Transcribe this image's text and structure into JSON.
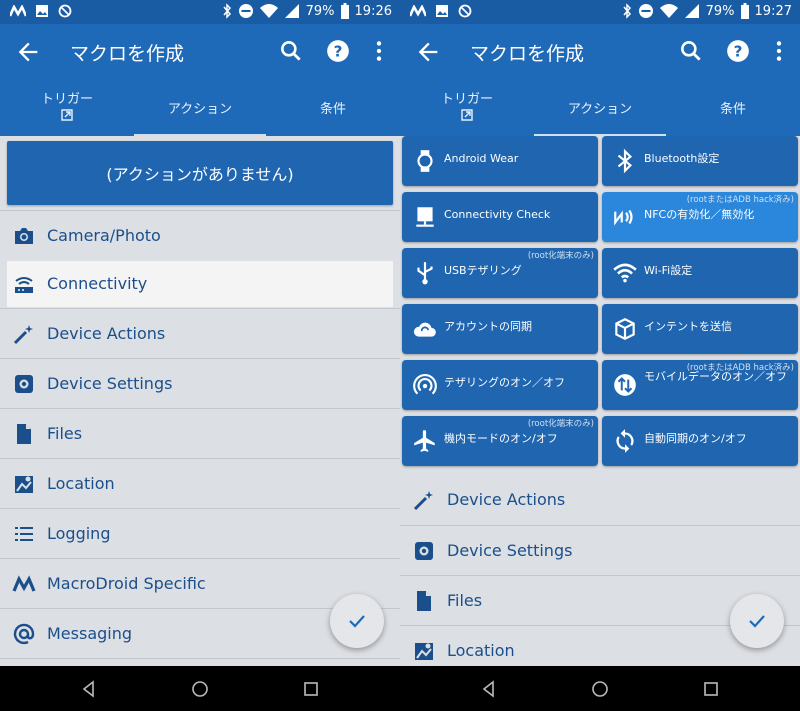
{
  "status": {
    "left_icons": [
      "macrodroid-icon",
      "image-icon",
      "dnd-circle-icon"
    ],
    "right_icons": [
      "bluetooth-icon",
      "dnd-icon",
      "wifi-icon",
      "signal-icon"
    ],
    "battery": "79%",
    "time_left": "19:26",
    "time_right": "19:27"
  },
  "appbar": {
    "title": "マクロを作成",
    "tabs": [
      {
        "label": "トリガー"
      },
      {
        "label": "アクション"
      },
      {
        "label": "条件"
      }
    ]
  },
  "left": {
    "no_action": "(アクションがありません)",
    "categories": [
      {
        "label": "Camera/Photo",
        "icon": "camera-icon"
      },
      {
        "label": "Connectivity",
        "icon": "router-icon",
        "selected": true
      },
      {
        "label": "Device Actions",
        "icon": "magic-wand-icon"
      },
      {
        "label": "Device Settings",
        "icon": "settings-gear-icon"
      },
      {
        "label": "Files",
        "icon": "file-icon"
      },
      {
        "label": "Location",
        "icon": "map-icon"
      },
      {
        "label": "Logging",
        "icon": "list-icon"
      },
      {
        "label": "MacroDroid Specific",
        "icon": "macrodroid-icon"
      },
      {
        "label": "Messaging",
        "icon": "at-icon"
      }
    ]
  },
  "right": {
    "actions": [
      {
        "label": "Android Wear",
        "icon": "watch-icon",
        "note": ""
      },
      {
        "label": "Bluetooth設定",
        "icon": "bluetooth-icon",
        "note": ""
      },
      {
        "label": "Connectivity Check",
        "icon": "network-check-icon",
        "note": ""
      },
      {
        "label": "NFCの有効化／無効化",
        "icon": "nfc-icon",
        "note": "(rootまたはADB hack済み)",
        "highlighted": true
      },
      {
        "label": "USBテザリング",
        "icon": "usb-icon",
        "note": "(root化端末のみ)"
      },
      {
        "label": "Wi-Fi設定",
        "icon": "wifi-icon",
        "note": ""
      },
      {
        "label": "アカウントの同期",
        "icon": "cloud-sync-icon",
        "note": ""
      },
      {
        "label": "インテントを送信",
        "icon": "cube-icon",
        "note": ""
      },
      {
        "label": "テザリングのオン／オフ",
        "icon": "hotspot-icon",
        "note": ""
      },
      {
        "label": "モバイルデータのオン／オフ",
        "icon": "mobile-data-icon",
        "note": "(rootまたはADB hack済み)"
      },
      {
        "label": "機内モードのオン/オフ",
        "icon": "airplane-icon",
        "note": "(root化端末のみ)"
      },
      {
        "label": "自動同期のオン/オフ",
        "icon": "sync-icon",
        "note": ""
      }
    ],
    "categories": [
      {
        "label": "Device Actions",
        "icon": "magic-wand-icon"
      },
      {
        "label": "Device Settings",
        "icon": "settings-gear-icon"
      },
      {
        "label": "Files",
        "icon": "file-icon"
      },
      {
        "label": "Location",
        "icon": "map-icon"
      }
    ]
  },
  "colors": {
    "status_bar": "#1a5ca4",
    "app_bar": "#1f6ab8",
    "button": "#1f65b0",
    "button_highlight": "#2a87dc",
    "list_bg": "#dcdfe3",
    "category_text": "#1b4f8c"
  }
}
